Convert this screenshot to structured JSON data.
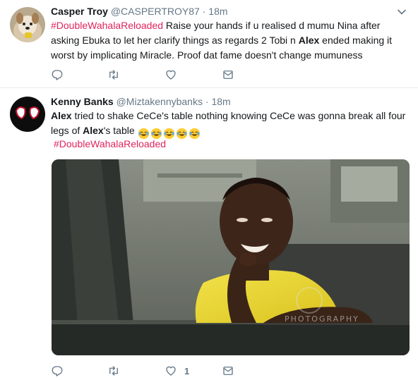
{
  "tweets": [
    {
      "author_name": "Casper Troy",
      "handle": "@CASPERTROY87",
      "separator": " · ",
      "time": "18m",
      "segments": [
        {
          "t": "#DoubleWahalaReloaded",
          "k": "hashtag"
        },
        {
          "t": " Raise your hands if u realised d mumu Nina after asking Ebuka to let her clarify things as regards 2 Tobi n ",
          "k": "plain"
        },
        {
          "t": "Alex",
          "k": "bold"
        },
        {
          "t": " ended making it worst by implicating Miracle. Proof dat fame doesn't change mumuness",
          "k": "plain"
        }
      ],
      "reply_count": "",
      "retweet_count": "",
      "like_count": ""
    },
    {
      "author_name": "Kenny Banks",
      "handle": "@Miztakennybanks",
      "separator": " · ",
      "time": "18m",
      "segments": [
        {
          "t": "Alex",
          "k": "bold"
        },
        {
          "t": " tried to shake CeCe's  table nothing knowing CeCe was gonna break all four legs of ",
          "k": "plain"
        },
        {
          "t": "Alex",
          "k": "bold"
        },
        {
          "t": "'s table ",
          "k": "plain"
        }
      ],
      "emoji": [
        "face-with-tears-of-joy",
        "face-with-tears-of-joy",
        "face-with-tears-of-joy",
        "face-with-tears-of-joy",
        "face-with-tears-of-joy"
      ],
      "hashtag_line": "#DoubleWahalaReloaded",
      "media_watermark": "PHOTOGRAPHY",
      "reply_count": "",
      "retweet_count": "",
      "like_count": "1"
    }
  ],
  "colors": {
    "hashtag": "#e0245e",
    "meta": "#657786",
    "icon": "#657786",
    "divider": "#e6ecf0"
  },
  "icons": [
    "chevron-down-icon",
    "reply-icon",
    "retweet-icon",
    "like-icon",
    "direct-message-icon"
  ]
}
